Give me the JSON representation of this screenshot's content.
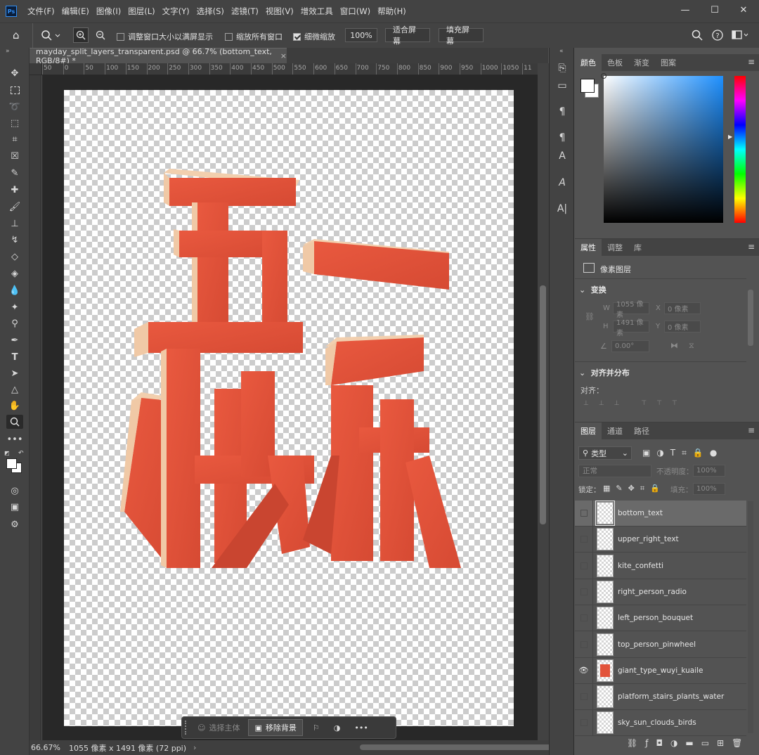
{
  "app": {
    "logo": "Ps",
    "menu": [
      "文件(F)",
      "编辑(E)",
      "图像(I)",
      "图层(L)",
      "文字(Y)",
      "选择(S)",
      "滤镜(T)",
      "视图(V)",
      "增效工具",
      "窗口(W)",
      "帮助(H)"
    ],
    "window_controls": [
      "minimize-icon",
      "maximize-icon",
      "close-icon"
    ]
  },
  "options_bar": {
    "resize_windows_label": "调整窗口大小以满屏显示",
    "resize_windows_checked": false,
    "zoom_all_label": "缩放所有窗口",
    "zoom_all_checked": false,
    "scrubby_zoom_label": "细微缩放",
    "scrubby_zoom_checked": true,
    "zoom_value": "100%",
    "fit_screen_label": "适合屏幕",
    "fill_screen_label": "填充屏幕"
  },
  "document": {
    "tab_title": "mayday_split_layers_transparent.psd @ 66.7% (bottom_text, RGB/8#) *",
    "ruler_labels": [
      "50",
      "0",
      "50",
      "100",
      "150",
      "200",
      "250",
      "300",
      "350",
      "400",
      "450",
      "500",
      "550",
      "600",
      "650",
      "700",
      "750",
      "800",
      "850",
      "900",
      "950",
      "1000",
      "1050",
      "11"
    ],
    "status_zoom": "66.67%",
    "status_info": "1055 像素 x 1491 像素 (72 ppi)",
    "artwork_text": [
      "五",
      "一",
      "快",
      "乐"
    ]
  },
  "context_bar": {
    "select_subject": "选择主体",
    "remove_background": "移除背景"
  },
  "color_panel": {
    "tabs": [
      "颜色",
      "色板",
      "渐变",
      "图案"
    ],
    "foreground": "#ffffff",
    "background": "#ffffff"
  },
  "properties_panel": {
    "tabs": [
      "属性",
      "调整",
      "库"
    ],
    "layer_type": "像素图层",
    "transform_title": "变换",
    "w_label": "W",
    "w_value": "1055 像素",
    "x_label": "X",
    "x_value": "0 像素",
    "h_label": "H",
    "h_value": "1491 像素",
    "y_label": "Y",
    "y_value": "0 像素",
    "angle_value": "0.00°",
    "align_title": "对齐并分布",
    "align_label": "对齐："
  },
  "layers_panel": {
    "tabs": [
      "图层",
      "通道",
      "路径"
    ],
    "filter_label": "类型",
    "blend_mode": "正常",
    "opacity_label": "不透明度：",
    "opacity_value": "100%",
    "lock_label": "锁定：",
    "fill_label": "填充：",
    "fill_value": "100%",
    "layers": [
      {
        "name": "bottom_text",
        "visible": false,
        "selected": true
      },
      {
        "name": "upper_right_text",
        "visible": false,
        "selected": false
      },
      {
        "name": "kite_confetti",
        "visible": false,
        "selected": false
      },
      {
        "name": "right_person_radio",
        "visible": false,
        "selected": false
      },
      {
        "name": "left_person_bouquet",
        "visible": false,
        "selected": false
      },
      {
        "name": "top_person_pinwheel",
        "visible": false,
        "selected": false
      },
      {
        "name": "giant_type_wuyi_kuaile",
        "visible": true,
        "selected": false
      },
      {
        "name": "platform_stairs_plants_water",
        "visible": false,
        "selected": false
      },
      {
        "name": "sky_sun_clouds_birds",
        "visible": false,
        "selected": false
      }
    ]
  },
  "colors": {
    "type_red": "#e2533a",
    "type_side": "#f0c9a6",
    "type_shadow": "#b83e2a"
  }
}
